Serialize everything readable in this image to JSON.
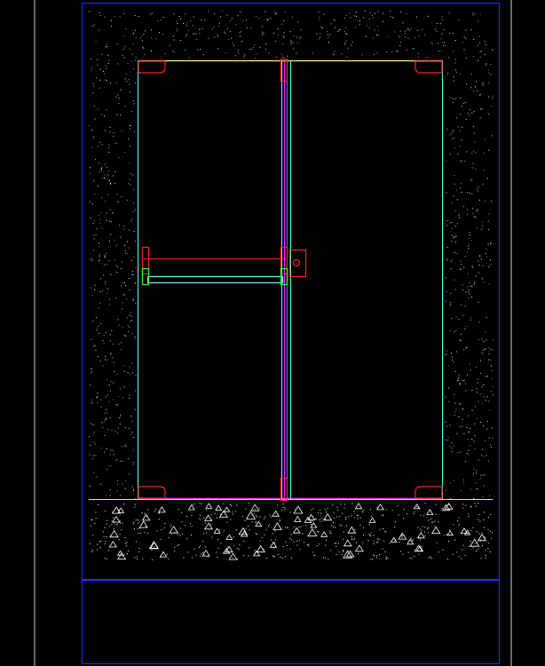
{
  "drawing": {
    "kind": "double-door-elevation-cad",
    "background": "#000000",
    "colors": {
      "outline_white": "#d9d9d9",
      "frame_blue": "#2a2aff",
      "wall_hatch": "#ffffff",
      "door_outline": "#55ffff",
      "head_line": "#ffff55",
      "floor_line": "#ffff00",
      "threshold": "#ff33ff",
      "hardware_red": "#ff2020",
      "meeting_stile_magenta": "#ff2dff",
      "meeting_stile_blue": "#3a6bff",
      "push_bar": "#66ffff",
      "bar_bracket_green": "#22ff22",
      "concrete": "#ffffff"
    },
    "icons": [
      "hinge-icon",
      "panic-bar-icon",
      "lock-icon",
      "flush-bolt-icon"
    ]
  }
}
